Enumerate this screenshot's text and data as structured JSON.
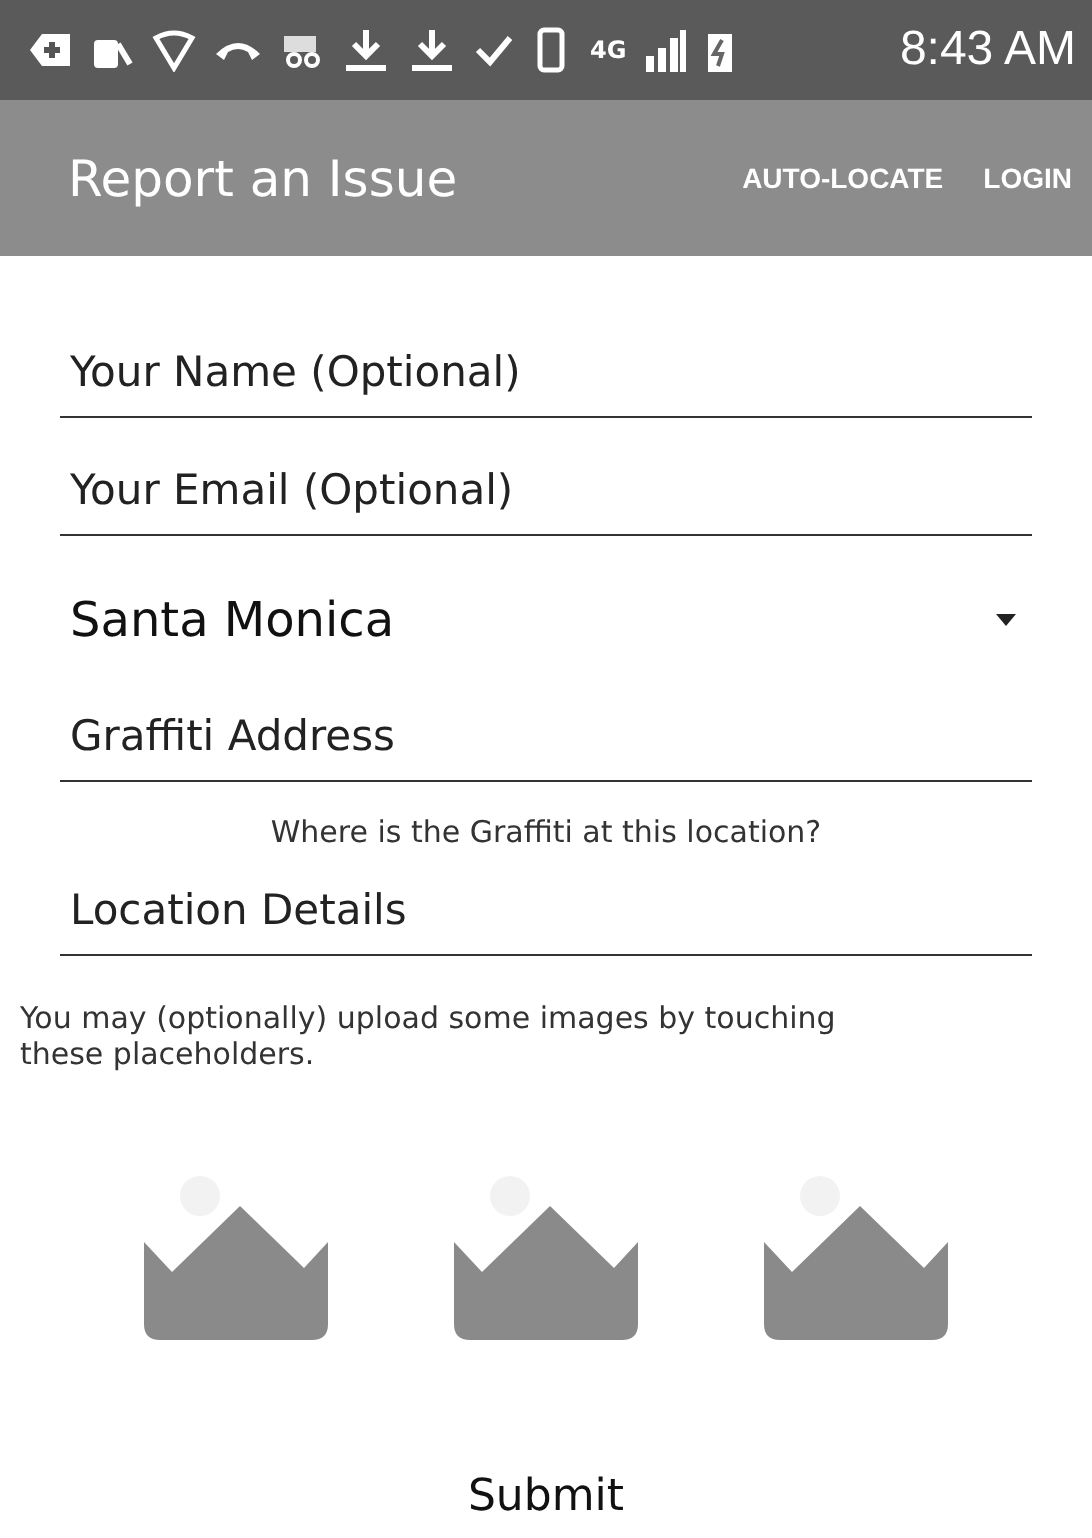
{
  "status_bar": {
    "network": "4G",
    "time": "8:43 AM"
  },
  "app_bar": {
    "title": "Report an Issue",
    "actions": [
      "AUTO-LOCATE",
      "LOGIN"
    ]
  },
  "form": {
    "fields": [
      {
        "kind": "input",
        "placeholder": "Your Name (Optional)"
      },
      {
        "kind": "input",
        "placeholder": "Your Email (Optional)"
      },
      {
        "kind": "spinner",
        "value": "Santa Monica"
      },
      {
        "kind": "input",
        "placeholder": "Graffiti Address"
      },
      {
        "kind": "hint",
        "text": "Where is the Graffiti at this location?"
      },
      {
        "kind": "input",
        "placeholder": "Location Details"
      }
    ],
    "upload_note": "You may (optionally) upload some images by touching these placeholders.",
    "submit": "Submit"
  }
}
